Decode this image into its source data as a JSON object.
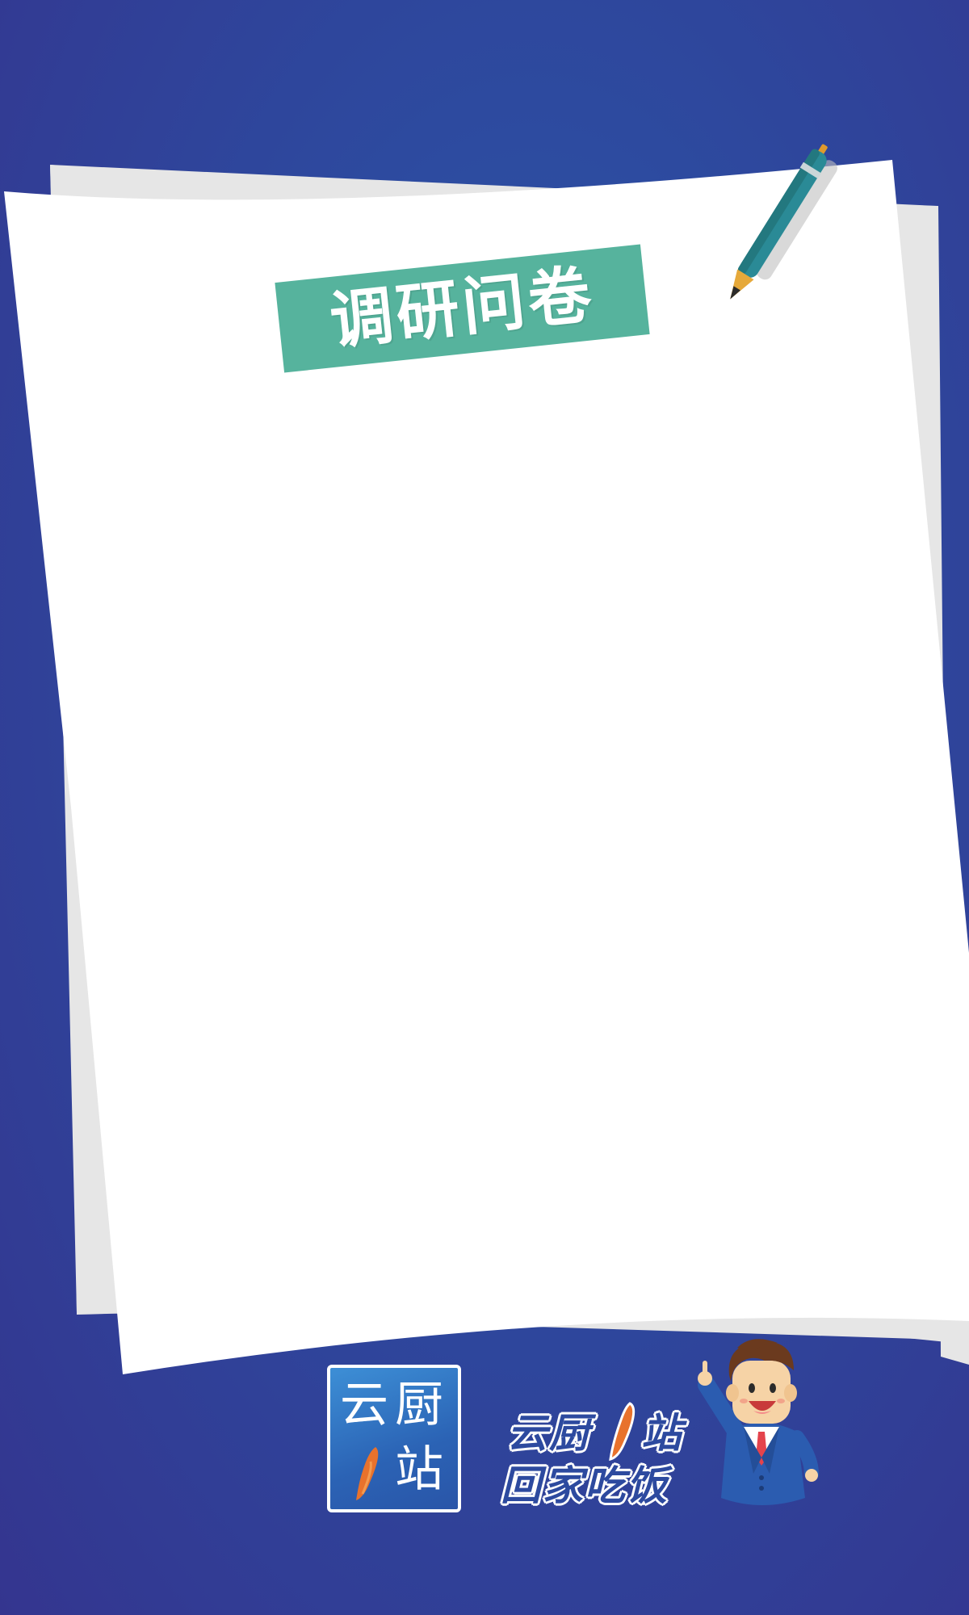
{
  "title": "调研问卷",
  "logo": {
    "char_top_left": "云",
    "char_top_right": "厨",
    "char_bottom_right": "站"
  },
  "slogan": {
    "line1_left": "云厨",
    "line1_right": "站",
    "line2": "回家吃饭"
  },
  "colors": {
    "background": "#2f4ba0",
    "banner": "#56b39d",
    "paper": "#ffffff",
    "paper_shadow": "#e6e6e6",
    "accent_orange": "#e8722c"
  },
  "icons": [
    "pen-icon",
    "brush-swash-icon",
    "mascot-businessman"
  ]
}
